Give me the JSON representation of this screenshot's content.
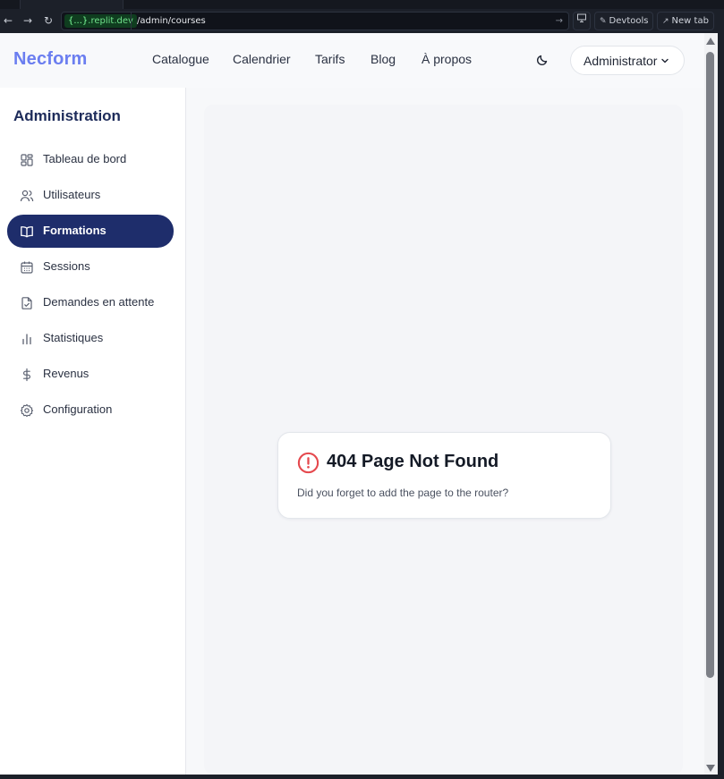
{
  "browser": {
    "url_host": ".replit.dev",
    "url_host_badge": "{...}",
    "url_path": "/admin/courses",
    "devtools_label": "Devtools",
    "newtab_label": "New tab"
  },
  "header": {
    "logo": "Necform",
    "nav": [
      "Catalogue",
      "Calendrier",
      "Tarifs",
      "Blog",
      "À propos"
    ],
    "user_menu_label": "Administrator"
  },
  "sidebar": {
    "title": "Administration",
    "items": [
      {
        "label": "Tableau de bord",
        "icon": "dashboard-icon",
        "active": false
      },
      {
        "label": "Utilisateurs",
        "icon": "users-icon",
        "active": false
      },
      {
        "label": "Formations",
        "icon": "book-open-icon",
        "active": true
      },
      {
        "label": "Sessions",
        "icon": "calendar-icon",
        "active": false
      },
      {
        "label": "Demandes en attente",
        "icon": "file-check-icon",
        "active": false
      },
      {
        "label": "Statistiques",
        "icon": "bar-chart-icon",
        "active": false
      },
      {
        "label": "Revenus",
        "icon": "dollar-icon",
        "active": false
      },
      {
        "label": "Configuration",
        "icon": "gear-icon",
        "active": false
      }
    ]
  },
  "error_card": {
    "title": "404 Page Not Found",
    "message": "Did you forget to add the page to the router?"
  },
  "colors": {
    "brand": "#6b7ef0",
    "active_nav": "#1e2d6b",
    "error": "#e5484d"
  }
}
